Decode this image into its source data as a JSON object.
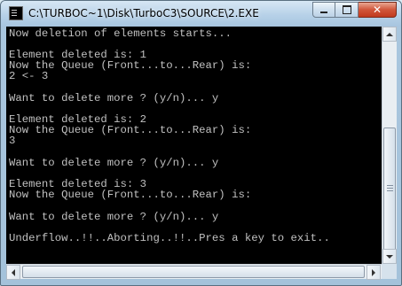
{
  "window": {
    "title": "C:\\TURBOC~1\\Disk\\TurboC3\\SOURCE\\2.EXE",
    "controls": {
      "minimize": "minimize",
      "maximize": "maximize",
      "close": "close"
    }
  },
  "console": {
    "lines": [
      "Now deletion of elements starts...",
      "",
      "Element deleted is: 1",
      "Now the Queue (Front...to...Rear) is:",
      "2 <- 3",
      "",
      "Want to delete more ? (y/n)... y",
      "",
      "Element deleted is: 2",
      "Now the Queue (Front...to...Rear) is:",
      "3",
      "",
      "Want to delete more ? (y/n)... y",
      "",
      "Element deleted is: 3",
      "Now the Queue (Front...to...Rear) is:",
      "",
      "Want to delete more ? (y/n)... y",
      "",
      "Underflow..!!..Aborting..!!..Pres a key to exit.."
    ]
  },
  "colors": {
    "console_bg": "#000000",
    "console_text": "#c0c0c0",
    "close_button": "#c23a1e",
    "titlebar": "#b7d1e8"
  },
  "scrollbars": {
    "vertical_position": 0.53,
    "horizontal_position": 0.0
  }
}
